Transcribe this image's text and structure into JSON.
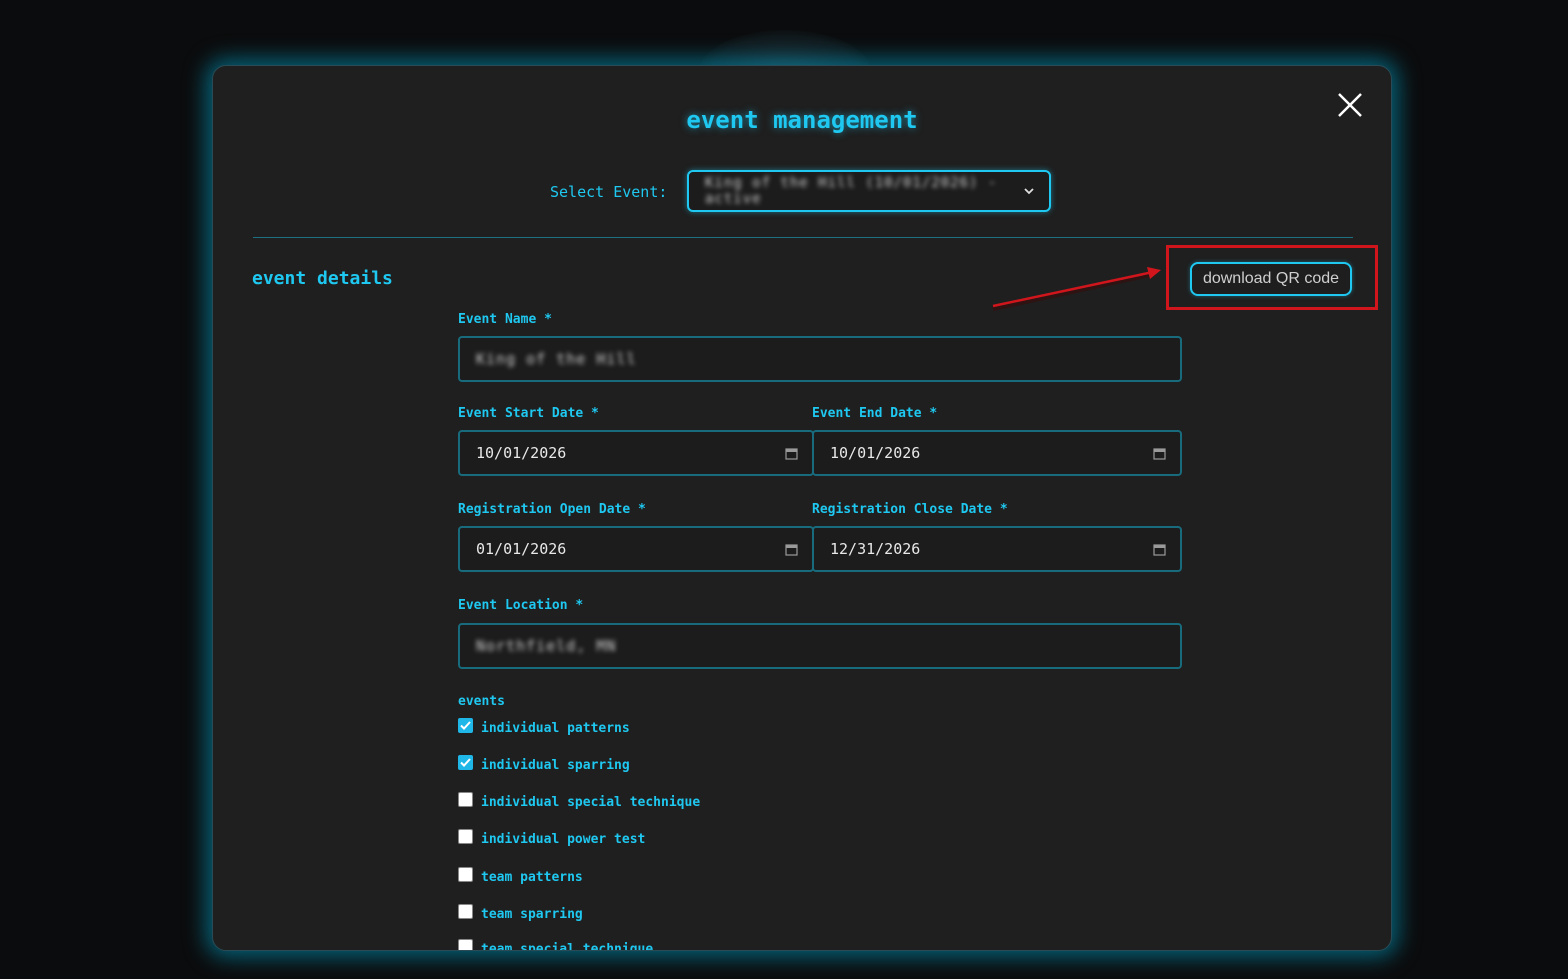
{
  "modal": {
    "title": "event management",
    "close_icon": "close-icon"
  },
  "select_event": {
    "label": "Select Event:",
    "value": "King of the Hill (10/01/2026) - active"
  },
  "details": {
    "section_title": "event details",
    "download_qr_label": "download QR code",
    "event_name": {
      "label": "Event Name *",
      "value": "King of the Hill"
    },
    "start_date": {
      "label": "Event Start Date *",
      "value": "10/01/2026"
    },
    "end_date": {
      "label": "Event End Date *",
      "value": "10/01/2026"
    },
    "reg_open": {
      "label": "Registration Open Date *",
      "value": "01/01/2026"
    },
    "reg_close": {
      "label": "Registration Close Date *",
      "value": "12/31/2026"
    },
    "location": {
      "label": "Event Location *",
      "value": "Northfield, MN"
    }
  },
  "events": {
    "label": "events",
    "items": [
      {
        "label": "individual patterns",
        "checked": true
      },
      {
        "label": "individual sparring",
        "checked": true
      },
      {
        "label": "individual special technique",
        "checked": false
      },
      {
        "label": "individual power test",
        "checked": false
      },
      {
        "label": "team patterns",
        "checked": false
      },
      {
        "label": "team sparring",
        "checked": false
      },
      {
        "label": "team special technique",
        "checked": false
      }
    ]
  },
  "colors": {
    "accent": "#1fc8f0",
    "highlight": "#d0161c",
    "panel": "#1f1f1f",
    "background": "#0b0c0d"
  }
}
